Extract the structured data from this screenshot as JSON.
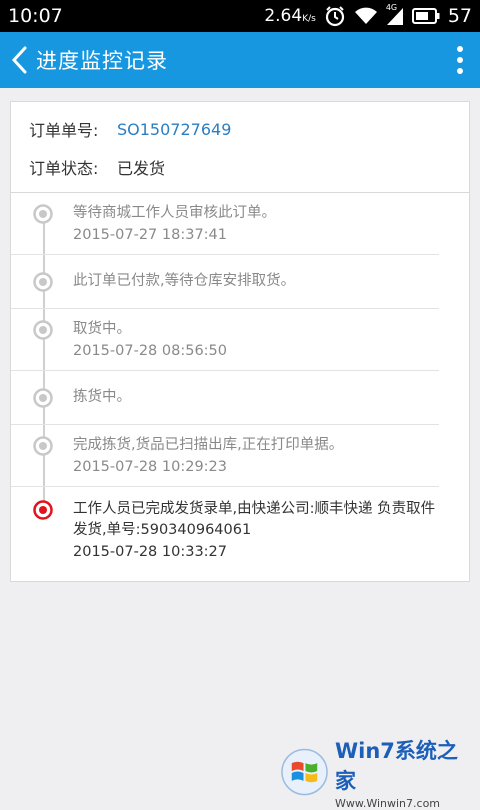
{
  "status_bar": {
    "time": "10:07",
    "data_rate": "2.64",
    "data_unit": "K/s",
    "network": "4G",
    "battery": "57",
    "icons": [
      "alarm-icon",
      "wifi-icon",
      "signal-icon",
      "battery-icon"
    ]
  },
  "app_bar": {
    "title": "进度监控记录",
    "color": "#1797e0"
  },
  "order": {
    "number_label": "订单单号:",
    "number_value": "SO150727649",
    "status_label": "订单状态:",
    "status_value": "已发货"
  },
  "timeline": [
    {
      "text": "等待商城工作人员审核此订单。",
      "time": "2015-07-27 18:37:41",
      "active": false
    },
    {
      "text": "此订单已付款,等待仓库安排取货。",
      "time": "",
      "active": false
    },
    {
      "text": "取货中。",
      "time": "2015-07-28 08:56:50",
      "active": false
    },
    {
      "text": "拣货中。",
      "time": "",
      "active": false
    },
    {
      "text": "完成拣货,货品已扫描出库,正在打印单据。",
      "time": "2015-07-28 10:29:23",
      "active": false
    },
    {
      "text": "工作人员已完成发货录单,由快递公司:顺丰快递 负责取件发货,单号:590340964061",
      "time": "2015-07-28 10:33:27",
      "active": true
    }
  ],
  "watermark": {
    "big": "Win7系统之家",
    "small": "Www.Winwin7.com"
  },
  "colors": {
    "accent": "#1797e0",
    "active_dot": "#e0141e",
    "inactive_dot": "#c8c8c8",
    "link": "#2a7fc4"
  }
}
